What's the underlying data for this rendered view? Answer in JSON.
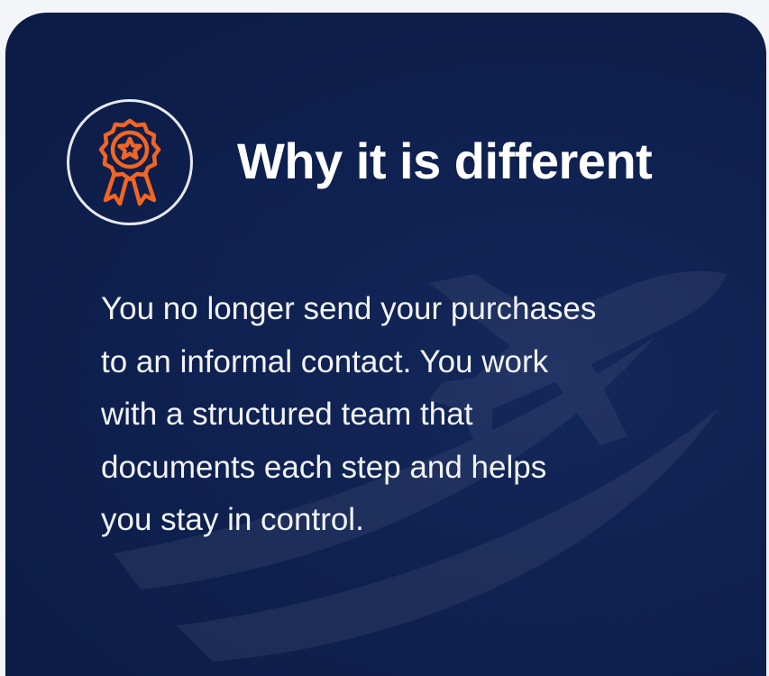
{
  "card": {
    "title": "Why it is different",
    "icon": "award-ribbon-icon",
    "body_lines": [
      "You no longer send your purchases",
      "to an informal contact. You work",
      "with a structured team that",
      "documents each step and helps",
      "you stay in control."
    ],
    "watermark_icon": "airplane-swoosh-icon"
  },
  "colors": {
    "background": "#0f2150",
    "accent": "#f26522",
    "text": "#ffffff"
  }
}
